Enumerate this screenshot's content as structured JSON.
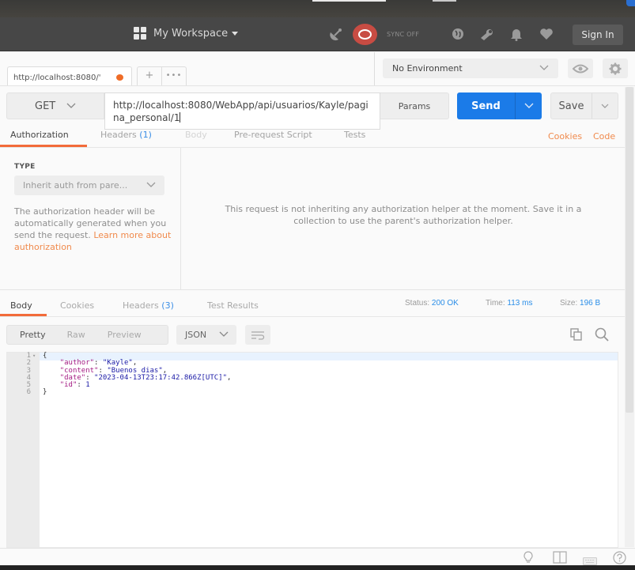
{
  "header": {
    "workspace_label": "My Workspace",
    "sync_label": "SYNC OFF",
    "signin_label": "Sign In"
  },
  "tabs": {
    "request_tab_title": "http://localhost:8080/'",
    "request_tab_unsaved": true,
    "add_tab_label": "+",
    "more_tabs_label": "•••"
  },
  "environment": {
    "selected": "No Environment"
  },
  "request": {
    "method": "GET",
    "url": "http://localhost:8080/WebApp/api/usuarios/Kayle/pagina_personal/1",
    "params_label": "Params",
    "send_label": "Send",
    "save_label": "Save"
  },
  "request_tabs": {
    "items": [
      {
        "label": "Authorization",
        "count": "",
        "state": "active"
      },
      {
        "label": "Headers",
        "count": "(1)",
        "state": "normal"
      },
      {
        "label": "Body",
        "count": "",
        "state": "disabled"
      },
      {
        "label": "Pre-request Script",
        "count": "",
        "state": "normal"
      },
      {
        "label": "Tests",
        "count": "",
        "state": "normal"
      }
    ],
    "cookies_link": "Cookies",
    "code_link": "Code"
  },
  "auth": {
    "type_label": "TYPE",
    "type_value": "Inherit auth from pare...",
    "description": "The authorization header will be automatically generated when you send the request.",
    "learn_more": "Learn more about authorization",
    "message": "This request is not inheriting any authorization helper at the moment. Save it in a collection to use the parent's authorization helper."
  },
  "response_tabs": {
    "items": [
      {
        "label": "Body",
        "count": "",
        "state": "active"
      },
      {
        "label": "Cookies",
        "count": "",
        "state": "normal"
      },
      {
        "label": "Headers",
        "count": "(3)",
        "state": "normal"
      },
      {
        "label": "Test Results",
        "count": "",
        "state": "normal"
      }
    ]
  },
  "response_stats": {
    "status_label": "Status:",
    "status_value": "200 OK",
    "time_label": "Time:",
    "time_value": "113 ms",
    "size_label": "Size:",
    "size_value": "196 B"
  },
  "response_format": {
    "modes": [
      "Pretty",
      "Raw",
      "Preview"
    ],
    "active_mode": "Pretty",
    "language": "JSON"
  },
  "response_body": {
    "lines": [
      {
        "num": "1",
        "fold": true,
        "tokens": [
          {
            "t": "p",
            "v": "{"
          }
        ]
      },
      {
        "num": "2",
        "fold": false,
        "tokens": [
          {
            "t": "p",
            "v": "    "
          },
          {
            "t": "k",
            "v": "\"author\""
          },
          {
            "t": "p",
            "v": ": "
          },
          {
            "t": "s",
            "v": "\"Kayle\""
          },
          {
            "t": "p",
            "v": ","
          }
        ]
      },
      {
        "num": "3",
        "fold": false,
        "tokens": [
          {
            "t": "p",
            "v": "    "
          },
          {
            "t": "k",
            "v": "\"content\""
          },
          {
            "t": "p",
            "v": ": "
          },
          {
            "t": "s",
            "v": "\"Buenos dias\""
          },
          {
            "t": "p",
            "v": ","
          }
        ]
      },
      {
        "num": "4",
        "fold": false,
        "tokens": [
          {
            "t": "p",
            "v": "    "
          },
          {
            "t": "k",
            "v": "\"date\""
          },
          {
            "t": "p",
            "v": ": "
          },
          {
            "t": "s",
            "v": "\"2023-04-13T23:17:42.866Z[UTC]\""
          },
          {
            "t": "p",
            "v": ","
          }
        ]
      },
      {
        "num": "5",
        "fold": false,
        "tokens": [
          {
            "t": "p",
            "v": "    "
          },
          {
            "t": "k",
            "v": "\"id\""
          },
          {
            "t": "p",
            "v": ": "
          },
          {
            "t": "n",
            "v": "1"
          }
        ]
      },
      {
        "num": "6",
        "fold": false,
        "tokens": [
          {
            "t": "p",
            "v": "}"
          }
        ]
      }
    ]
  },
  "colors": {
    "accent_orange": "#f26b3a",
    "send_blue": "#1b7be8",
    "link_orange": "#f08a4c",
    "stat_blue": "#2b8ee8",
    "sync_red": "#c84c43"
  }
}
